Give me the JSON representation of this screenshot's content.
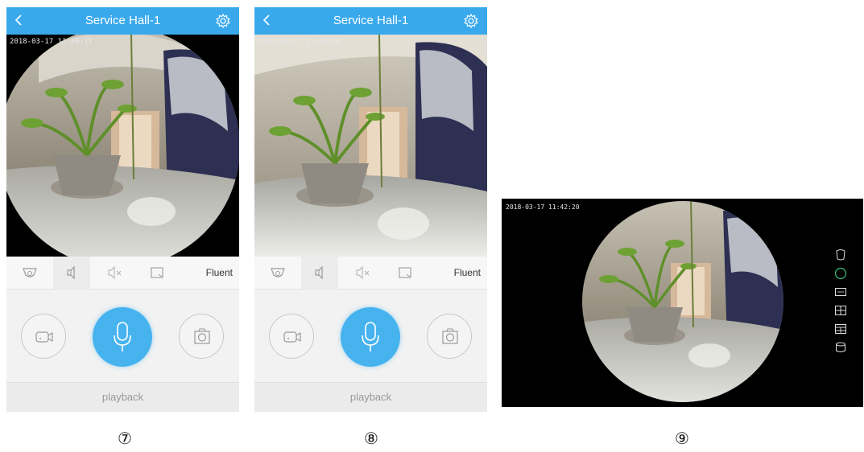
{
  "panels": [
    {
      "header": {
        "title": "Service Hall-1"
      },
      "timestamp": "2018-03-17  11:40:17",
      "toolbar": {
        "quality_label": "Fluent"
      },
      "playback_label": "playback",
      "caption": "⑦"
    },
    {
      "header": {
        "title": "Service Hall-1"
      },
      "timestamp": "2018-03-17  11:40:24",
      "toolbar": {
        "quality_label": "Fluent"
      },
      "playback_label": "playback",
      "caption": "⑧"
    }
  ],
  "landscape": {
    "timestamp": "2018-03-17  11:42:20",
    "caption": "⑨",
    "side_icons": [
      "fisheye-mode-icon",
      "circle-mode-icon",
      "panorama-mode-icon",
      "quad-split-icon",
      "split-view-icon",
      "cylinder-mode-icon"
    ]
  },
  "colors": {
    "accent": "#3aa9ec",
    "mic_button": "#46b3ef",
    "video_bg": "#000000"
  },
  "icons": {
    "header": [
      "back-icon",
      "gear-icon"
    ],
    "toolbar": [
      "fisheye-view-icon",
      "speaker-icon",
      "mute-icon",
      "fullscreen-icon"
    ],
    "controls": [
      "record-video-icon",
      "microphone-icon",
      "snapshot-icon"
    ]
  }
}
